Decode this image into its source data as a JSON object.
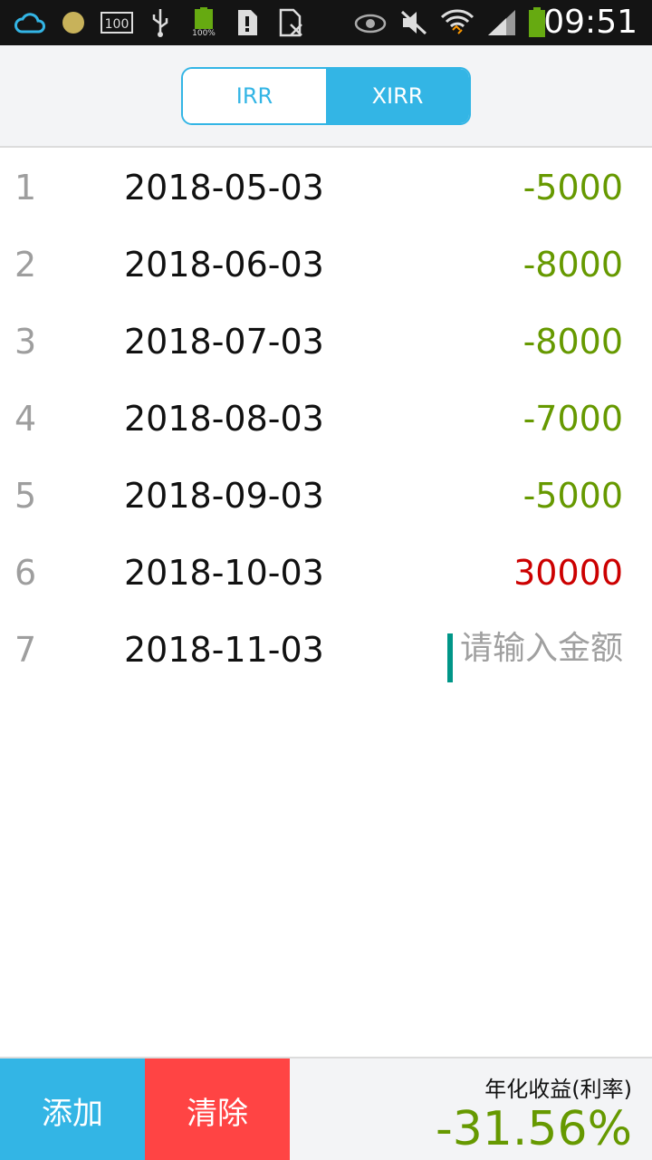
{
  "status_bar": {
    "time": "09:51",
    "battery_small_label": "100%",
    "storage_badge": "100",
    "icons": [
      "weather-cloud-icon",
      "dot-icon",
      "storage-icon",
      "usb-icon",
      "battery-full-icon",
      "sd-card-icon",
      "sim-icon",
      "eye-icon",
      "mute-icon",
      "wifi-icon",
      "signal-icon",
      "battery-icon"
    ]
  },
  "segment": {
    "tabs": [
      {
        "label": "IRR",
        "active": false
      },
      {
        "label": "XIRR",
        "active": true
      }
    ]
  },
  "rows": [
    {
      "index": "1",
      "date": "2018-05-03",
      "amount": "-5000",
      "sign": "neg"
    },
    {
      "index": "2",
      "date": "2018-06-03",
      "amount": "-8000",
      "sign": "neg"
    },
    {
      "index": "3",
      "date": "2018-07-03",
      "amount": "-8000",
      "sign": "neg"
    },
    {
      "index": "4",
      "date": "2018-08-03",
      "amount": "-7000",
      "sign": "neg"
    },
    {
      "index": "5",
      "date": "2018-09-03",
      "amount": "-5000",
      "sign": "neg"
    },
    {
      "index": "6",
      "date": "2018-10-03",
      "amount": "30000",
      "sign": "pos"
    },
    {
      "index": "7",
      "date": "2018-11-03",
      "amount": "",
      "placeholder": "请输入金额"
    }
  ],
  "footer": {
    "add_label": "添加",
    "clear_label": "清除",
    "result_label": "年化收益(利率)",
    "result_value": "-31.56%"
  },
  "colors": {
    "accent": "#33b5e5",
    "danger": "#ff4444",
    "negative": "#669900",
    "positive": "#cc0000"
  }
}
